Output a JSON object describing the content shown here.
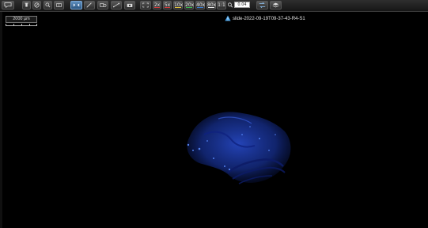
{
  "toolbar": {
    "buttons": [
      {
        "name": "comment-icon",
        "label": ""
      },
      {
        "name": "home-icon",
        "label": ""
      },
      {
        "name": "navigator-icon",
        "label": ""
      },
      {
        "name": "search-icon",
        "label": ""
      },
      {
        "name": "list-icon",
        "label": ""
      },
      {
        "name": "fit-icon",
        "label": ""
      },
      {
        "name": "pen-icon",
        "label": ""
      },
      {
        "name": "shapes-icon",
        "label": ""
      },
      {
        "name": "measure-icon",
        "label": ""
      },
      {
        "name": "camera-icon",
        "label": ""
      },
      {
        "name": "fullscreen-icon",
        "label": ""
      }
    ],
    "zoom_levels": [
      {
        "label": "2x",
        "color": "#d23b3b"
      },
      {
        "label": "5x",
        "color": "#d23b3b"
      },
      {
        "label": "10x",
        "color": "#e0c23a"
      },
      {
        "label": "20x",
        "color": "#3ab64c"
      },
      {
        "label": "40x",
        "color": "#3a7bd0"
      },
      {
        "label": "80x",
        "color": "#e8e8e8"
      }
    ],
    "ratio_label": "1:1",
    "zoom_value": "0.04",
    "tools_right": [
      {
        "name": "sync-icon",
        "label": ""
      },
      {
        "name": "layers-icon",
        "label": ""
      }
    ]
  },
  "scale": {
    "label": "2000 µm"
  },
  "slide": {
    "name": "slide-2022-09-19T09-37-43-R4-S1",
    "icon": "warning-icon",
    "warning_color": "#4aa3e8"
  },
  "colors": {
    "background": "#000000",
    "tissue": "#1f3cb0"
  }
}
